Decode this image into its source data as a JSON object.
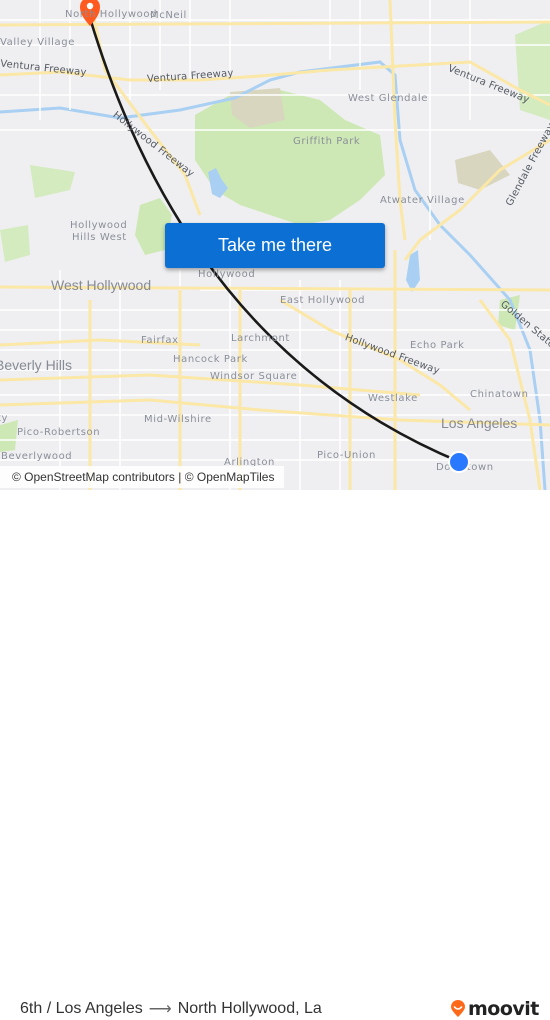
{
  "map": {
    "labels": {
      "north_hollywood": "North Hollywood",
      "mcneil": "McNeil",
      "valley_village": "Valley Village",
      "ventura_fwy_w": "Ventura Freeway",
      "ventura_fwy_c": "Ventura Freeway",
      "ventura_fwy_e": "Ventura Freeway",
      "west_glendale": "West Glendale",
      "griffith_park": "Griffith Park",
      "hollywood_fwy_n": "Hollywood Freeway",
      "glendale_fwy": "Glendale Freeway",
      "atwater_village": "Atwater Village",
      "hollywood_hills_west_1": "Hollywood",
      "hollywood_hills_west_2": "Hills West",
      "west_hollywood": "West Hollywood",
      "hollywood": "Hollywood",
      "east_hollywood": "East Hollywood",
      "golden_state_fwy": "Golden State Freeway",
      "larchmont": "Larchmont",
      "fairfax": "Fairfax",
      "beverly_hills": "Beverly Hills",
      "hancock_park": "Hancock Park",
      "hollywood_fwy_s": "Hollywood Freeway",
      "echo_park": "Echo Park",
      "windsor_square": "Windsor Square",
      "westlake": "Westlake",
      "chinatown": "Chinatown",
      "city": "City",
      "mid_wilshire": "Mid-Wilshire",
      "los_angeles": "Los Angeles",
      "pico_robertson": "Pico-Robertson",
      "pico_union": "Pico-Union",
      "beverlywood": "Beverlywood",
      "arlington": "Arlington",
      "downtown": "Downtown"
    },
    "cta_button": "Take me there",
    "attribution": "© OpenStreetMap contributors | © OpenMapTiles",
    "origin_marker_color": "#2979ff",
    "destination_marker_color": "#ff5a1f",
    "route_color": "#1a1a1a"
  },
  "footer": {
    "origin": "6th / Los Angeles",
    "arrow": "⟶",
    "destination": "North Hollywood, La",
    "brand": "moovit",
    "brand_color": "#ff6a1a"
  }
}
